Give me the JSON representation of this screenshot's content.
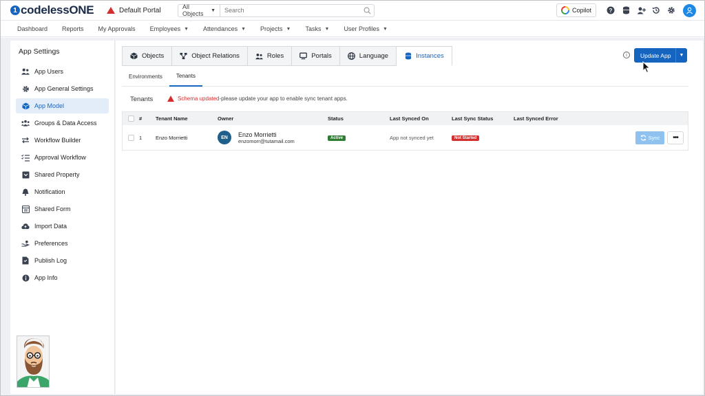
{
  "header": {
    "logo_text": "codelessONE",
    "logo_mark": "1",
    "portal": "Default Portal",
    "search_scope": "All Objects",
    "search_placeholder": "Search",
    "copilot": "Copilot",
    "icons": [
      "help-icon",
      "database-icon",
      "add-user-icon",
      "history-icon",
      "gear-icon",
      "user-avatar-icon"
    ]
  },
  "nav": {
    "items": [
      {
        "label": "Dashboard",
        "dropdown": false
      },
      {
        "label": "Reports",
        "dropdown": false
      },
      {
        "label": "My Approvals",
        "dropdown": false
      },
      {
        "label": "Employees",
        "dropdown": true
      },
      {
        "label": "Attendances",
        "dropdown": true
      },
      {
        "label": "Projects",
        "dropdown": true
      },
      {
        "label": "Tasks",
        "dropdown": true
      },
      {
        "label": "User Profiles",
        "dropdown": true
      }
    ]
  },
  "sidebar": {
    "title": "App Settings",
    "items": [
      {
        "label": "App Users",
        "icon": "users-icon"
      },
      {
        "label": "App General Settings",
        "icon": "gear-icon"
      },
      {
        "label": "App Model",
        "icon": "cube-icon",
        "active": true
      },
      {
        "label": "Groups & Data Access",
        "icon": "group-icon"
      },
      {
        "label": "Workflow Builder",
        "icon": "arrows-icon"
      },
      {
        "label": "Approval Workflow",
        "icon": "checklist-icon"
      },
      {
        "label": "Shared Property",
        "icon": "inbox-icon"
      },
      {
        "label": "Notification",
        "icon": "bell-icon"
      },
      {
        "label": "Shared Form",
        "icon": "form-icon"
      },
      {
        "label": "Import Data",
        "icon": "cloud-upload-icon"
      },
      {
        "label": "Preferences",
        "icon": "hand-icon"
      },
      {
        "label": "Publish Log",
        "icon": "file-icon"
      },
      {
        "label": "App Info",
        "icon": "info-icon"
      }
    ]
  },
  "tabs": {
    "items": [
      {
        "label": "Objects",
        "icon": "cube-icon"
      },
      {
        "label": "Object Relations",
        "icon": "relations-icon"
      },
      {
        "label": "Roles",
        "icon": "users-icon"
      },
      {
        "label": "Portals",
        "icon": "monitor-icon"
      },
      {
        "label": "Language",
        "icon": "globe-icon"
      },
      {
        "label": "Instances",
        "icon": "database-icon",
        "active": true
      }
    ],
    "update_button": "Update App"
  },
  "subtabs": {
    "items": [
      {
        "label": "Environments"
      },
      {
        "label": "Tenants",
        "active": true
      }
    ]
  },
  "tenants": {
    "title": "Tenants",
    "warning_highlight": "Schema updated",
    "warning_text": "-please update your app to enable sync tenant apps."
  },
  "table": {
    "columns": [
      "#",
      "Tenant Name",
      "Owner",
      "Status",
      "Last Synced On",
      "Last Sync Status",
      "Last Synced Error"
    ],
    "rows": [
      {
        "num": "1",
        "tenant_name": "Enzo Morrietti",
        "owner_initials": "EN",
        "owner_name": "Enzo Morrietti",
        "owner_email": "enzomorr@tutamail.com",
        "status": "Active",
        "last_synced_on": "App not synced yet",
        "last_sync_status": "Not Started",
        "last_synced_error": "",
        "sync_label": "Sync",
        "more_label": "•••"
      }
    ]
  },
  "colors": {
    "primary": "#1565c0",
    "active_badge": "#2e7d32",
    "error": "#d32f2f"
  }
}
